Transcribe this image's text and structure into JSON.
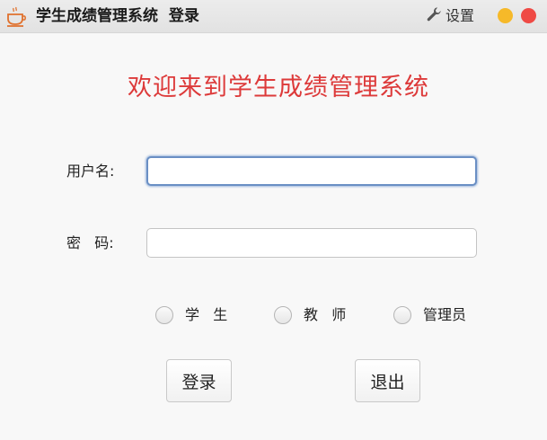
{
  "window": {
    "title": "学生成绩管理系统  登录",
    "settings_label": "设置",
    "icons": {
      "app": "coffee-cup-icon",
      "settings": "wrench-icon"
    },
    "colors": {
      "minimize": "#f6b929",
      "close": "#ef4a45"
    }
  },
  "heading": "欢迎来到学生成绩管理系统",
  "form": {
    "username_label": "用户名:",
    "username_value": "",
    "password_label": "密   码:",
    "password_value": ""
  },
  "roles": [
    {
      "label": "学   生",
      "selected": false
    },
    {
      "label": "教   师",
      "selected": false
    },
    {
      "label": "管理员",
      "selected": false
    }
  ],
  "buttons": {
    "login": "登录",
    "exit": "退出"
  }
}
